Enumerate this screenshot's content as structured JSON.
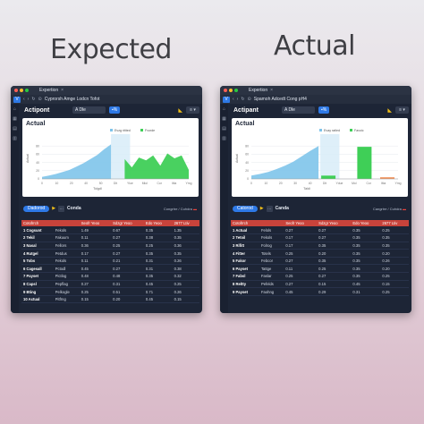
{
  "headings": {
    "expected": "Expected",
    "actual": "Actual"
  },
  "windows": [
    {
      "id": "expected",
      "tab_label": "Expertion",
      "app_letter": "V",
      "url": "Cyprorsh Amge Lodcn Tofot",
      "toolbar": {
        "title": "Actipont",
        "dropdown": "A Dle",
        "button": "%"
      },
      "card": {
        "title": "Actual",
        "legend": [
          "Evzg ritited",
          "Fvorde"
        ]
      },
      "bar2": {
        "pill": "Dadorod",
        "label": "Conda",
        "right_text": "Congrtre / Cuhdra"
      },
      "table": {
        "headers": [
          "Cotofrrch",
          "",
          "Seofr Yeoo",
          "Sdzgr Yeoo",
          "Edo Yeoo",
          "2677 Ltiv"
        ],
        "rows": [
          [
            "1 Cogsunt",
            "Fekols",
            "1.49",
            "0.67",
            "0.35",
            "1.35"
          ],
          [
            "2 Tekil",
            "Fakuum",
            "0.11",
            "0.27",
            "0.38",
            "0.35"
          ],
          [
            "3 Nasal",
            "Fellors",
            "0.36",
            "0.25",
            "0.25",
            "0.36"
          ],
          [
            "4 Rutgel",
            "Petdus",
            "0.17",
            "0.27",
            "0.35",
            "0.35"
          ],
          [
            "5 Tobs",
            "Fekols",
            "0.11",
            "0.21",
            "0.31",
            "0.26"
          ],
          [
            "6 Cagesall",
            "Pctodl",
            "0.45",
            "0.27",
            "0.31",
            "0.38"
          ],
          [
            "7 Payset",
            "Pictlog",
            "0.48",
            "0.48",
            "0.35",
            "0.32"
          ],
          [
            "8 Capsl",
            "Pepflag",
            "0.27",
            "0.31",
            "0.45",
            "0.25"
          ],
          [
            "9 Bting",
            "Pelkogle",
            "0.25",
            "0.51",
            "0.71",
            "0.26"
          ],
          [
            "10 Actual",
            "Pitfrng",
            "0.15",
            "0.20",
            "0.45",
            "0.15"
          ]
        ]
      },
      "chart_data": {
        "type": "area",
        "title": "Actual",
        "xlabel": "Tolgdl",
        "ylabel": "Actual",
        "ylim": [
          0,
          100
        ],
        "x_tick_labels": [
          "0",
          "10",
          "20",
          "40",
          "50",
          "Dlt",
          "Ylue",
          "Miol",
          "Cor",
          "Itlia",
          "Ymg"
        ],
        "y_tick_labels": [
          "0",
          "20",
          "40",
          "60",
          "80"
        ],
        "series": [
          {
            "name": "Evzg ritited",
            "color": "#7ec4ea",
            "values": [
              5,
              8,
              12,
              17,
              22,
              30,
              38,
              48,
              58,
              72,
              84
            ]
          },
          {
            "name": "Fvorde",
            "color": "#3fcf57",
            "values": [
              48,
              28,
              52,
              45,
              57,
              32,
              62,
              50,
              57,
              22
            ]
          }
        ],
        "highlight_band": true
      }
    },
    {
      "id": "actual",
      "tab_label": "Expertion",
      "app_letter": "V",
      "url": "Spamoh Adcedt Cong pH4",
      "toolbar": {
        "title": "Actipant",
        "dropdown": "A Dle",
        "button": "%"
      },
      "card": {
        "title": "Actual",
        "legend": [
          "Evay ratled",
          "Favoic"
        ]
      },
      "bar2": {
        "pill": "Catorod",
        "label": "Canda",
        "right_text": "Cangrtre / Cuhdra"
      },
      "table": {
        "headers": [
          "Cotofrrch",
          "",
          "Seofr Yeoo",
          "Sdzgr Yeoo",
          "Edo Yeoo",
          "2677 Ltiv"
        ],
        "rows": [
          [
            "1 Actual",
            "Felols",
            "0.27",
            "0.27",
            "0.35",
            "0.25"
          ],
          [
            "2 Tetoil",
            "Fekols",
            "0.17",
            "0.27",
            "0.35",
            "0.35"
          ],
          [
            "3 Rifitt",
            "Folrog",
            "0.17",
            "0.35",
            "0.35",
            "0.35"
          ],
          [
            "4 Fitter",
            "Totels",
            "0.25",
            "0.20",
            "0.35",
            "0.20"
          ],
          [
            "5 Fakor",
            "Febcor",
            "0.27",
            "0.35",
            "0.35",
            "0.26"
          ],
          [
            "6 Payset",
            "Tattge",
            "0.11",
            "0.25",
            "0.35",
            "0.20"
          ],
          [
            "7 Fabsl",
            "Faslar",
            "0.25",
            "0.27",
            "0.35",
            "0.25"
          ],
          [
            "8 Reltty",
            "Pefelds",
            "0.27",
            "0.15",
            "0.45",
            "0.15"
          ],
          [
            "9 Payset",
            "Faohng",
            "0.45",
            "0.29",
            "0.31",
            "0.25"
          ]
        ]
      },
      "chart_data": {
        "type": "bar",
        "title": "Actual",
        "xlabel": "Taldi",
        "ylabel": "Actual",
        "ylim": [
          0,
          100
        ],
        "x_tick_labels": [
          "0",
          "10",
          "20",
          "30",
          "40",
          "Dlt",
          "Ydue",
          "Mol",
          "Cor",
          "Iltia",
          "Ymg"
        ],
        "y_tick_labels": [
          "0",
          "20",
          "40",
          "60",
          "80"
        ],
        "series": [
          {
            "name": "Evay ratled",
            "color": "#7ec4ea",
            "values": [
              8,
              12,
              17,
              24,
              32,
              42,
              55,
              68,
              80
            ]
          },
          {
            "name": "Favoic",
            "color": "#3fcf57",
            "values": [
              8,
              78
            ]
          },
          {
            "name": "",
            "color": "#f2935b",
            "values": [
              4
            ]
          }
        ],
        "highlight_band": true
      }
    }
  ]
}
